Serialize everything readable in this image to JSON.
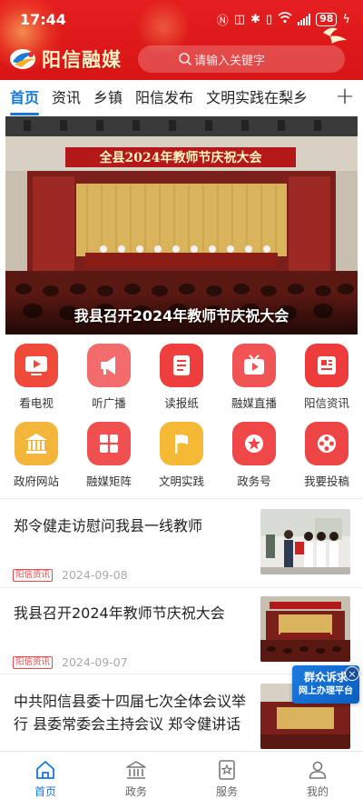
{
  "status_bar": {
    "time": "17:44",
    "battery": "98"
  },
  "header": {
    "logo_text": "阳信融媒",
    "search_placeholder": "请输入关键字"
  },
  "tabs": [
    {
      "label": "首页",
      "active": true
    },
    {
      "label": "资讯"
    },
    {
      "label": "乡镇"
    },
    {
      "label": "阳信发布"
    },
    {
      "label": "文明实践在梨乡"
    }
  ],
  "add_tab_label": "+",
  "banner": {
    "slogan": "全县2024年教师节庆祝大会",
    "caption": "我县召开2024年教师节庆祝大会"
  },
  "grid": [
    {
      "label": "看电视",
      "icon": "tv-play-icon",
      "color": "#f04a3a"
    },
    {
      "label": "听广播",
      "icon": "megaphone-icon",
      "color": "#f26c6c"
    },
    {
      "label": "读报纸",
      "icon": "newspaper-icon",
      "color": "#ef3e3e"
    },
    {
      "label": "融媒直播",
      "icon": "live-tv-icon",
      "color": "#f05454"
    },
    {
      "label": "阳信资讯",
      "icon": "news-doc-icon",
      "color": "#ee3c3c"
    },
    {
      "label": "政府网站",
      "icon": "government-building-icon",
      "color": "#f4b63a"
    },
    {
      "label": "融媒矩阵",
      "icon": "matrix-grid-icon",
      "color": "#f05050"
    },
    {
      "label": "文明实践",
      "icon": "flag-icon",
      "color": "#f6b935"
    },
    {
      "label": "政务号",
      "icon": "star-badge-icon",
      "color": "#f04848"
    },
    {
      "label": "我要投稿",
      "icon": "film-reel-icon",
      "color": "#ee4646"
    }
  ],
  "news": [
    {
      "title": "郑令健走访慰问我县一线教师",
      "source": "阳信资讯",
      "date": "2024-09-08"
    },
    {
      "title": "我县召开2024年教师节庆祝大会",
      "source": "阳信资讯",
      "date": "2024-09-07"
    },
    {
      "title": "中共阳信县委十四届七次全体会议举行 县委常委会主持会议 郑令健讲话",
      "source": "",
      "date": ""
    }
  ],
  "float_ad": {
    "line1": "群众诉求",
    "line2": "网上办理平台",
    "close": "×"
  },
  "bottom_nav": [
    {
      "label": "首页",
      "icon": "home-icon",
      "active": true
    },
    {
      "label": "政务",
      "icon": "government-icon"
    },
    {
      "label": "服务",
      "icon": "service-star-icon"
    },
    {
      "label": "我的",
      "icon": "profile-icon"
    }
  ],
  "colors": {
    "brand_red": "#e51f1f",
    "accent_blue": "#1677d9"
  }
}
